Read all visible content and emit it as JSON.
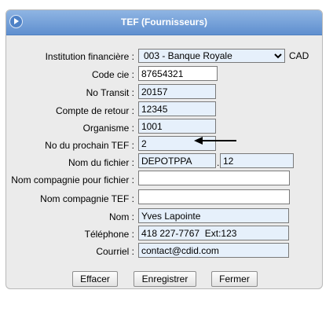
{
  "panel": {
    "title": "TEF (Fournisseurs)"
  },
  "form": {
    "institution": {
      "label": "Institution financière :",
      "value": "003 - Banque Royale",
      "options": [
        "003 - Banque Royale"
      ],
      "currency": "CAD"
    },
    "code_cie": {
      "label": "Code cie :",
      "value": "87654321"
    },
    "no_transit": {
      "label": "No Transit :",
      "value": "20157"
    },
    "compte_retour": {
      "label": "Compte de retour :",
      "value": "12345"
    },
    "organisme": {
      "label": "Organisme :",
      "value": "1001"
    },
    "no_prochain_tef": {
      "label": "No du prochain TEF :",
      "value": "2"
    },
    "nom_fichier": {
      "label": "Nom du fichier :",
      "value": "DEPOTPPA",
      "separator": ".",
      "extension": "12"
    },
    "nom_compagnie_fichier": {
      "label": "Nom compagnie pour fichier :",
      "value": ""
    },
    "nom_compagnie_tef": {
      "label": "Nom compagnie TEF :",
      "value": ""
    },
    "nom": {
      "label": "Nom :",
      "value": "Yves Lapointe"
    },
    "telephone": {
      "label": "Téléphone :",
      "value": "418 227-7767  Ext:123"
    },
    "courriel": {
      "label": "Courriel :",
      "value": "contact@cdid.com"
    }
  },
  "buttons": {
    "effacer": "Effacer",
    "enregistrer": "Enregistrer",
    "fermer": "Fermer"
  },
  "colors": {
    "title_bar": "#6f9bd6",
    "field_highlight": "#e6f0fb",
    "panel_bg": "#ebebeb"
  },
  "icons": {
    "collapse": "circle-arrow-right-icon",
    "annotation": "arrow-left-icon"
  }
}
